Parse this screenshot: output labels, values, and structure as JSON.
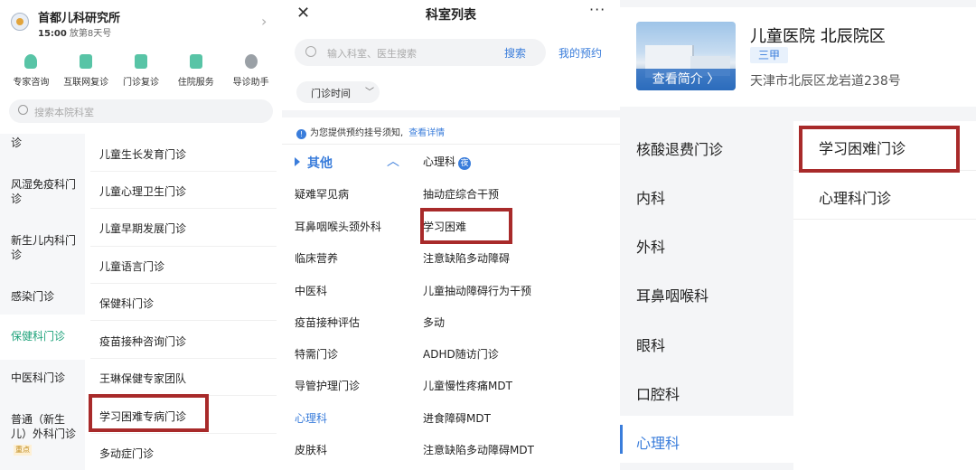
{
  "panel1": {
    "hospital_name": "首都儿科研究所",
    "time": "15:00",
    "day_info": "放第8天号",
    "quick_actions": [
      {
        "label": "专家咨询",
        "icon": "expert-consult-icon",
        "color": "#58c4a6"
      },
      {
        "label": "互联网复诊",
        "icon": "online-revisit-icon",
        "color": "#58c4a6"
      },
      {
        "label": "门诊复诊",
        "icon": "outpatient-revisit-icon",
        "color": "#58c4a6"
      },
      {
        "label": "住院服务",
        "icon": "inpatient-service-icon",
        "color": "#58c4a6"
      },
      {
        "label": "导诊助手",
        "icon": "guide-assistant-icon",
        "color": "#9aa0a6"
      }
    ],
    "search_placeholder": "搜索本院科室",
    "left_menu": [
      {
        "label": "诊"
      },
      {
        "label": "风湿免疫科门诊"
      },
      {
        "label": "新生儿内科门诊"
      },
      {
        "label": "感染门诊"
      },
      {
        "label": "保健科门诊",
        "active": true
      },
      {
        "label": "中医科门诊"
      },
      {
        "label": "普通（新生儿）外科门诊",
        "tag": "重点"
      }
    ],
    "right_list": [
      "儿童生长发育门诊",
      "儿童心理卫生门诊",
      "儿童早期发展门诊",
      "儿童语言门诊",
      "保健科门诊",
      "疫苗接种咨询门诊",
      "王琳保健专家团队",
      "学习困难专病门诊",
      "多动症门诊"
    ]
  },
  "panel2": {
    "title": "科室列表",
    "search_placeholder": "输入科室、医生搜索",
    "search_button": "搜索",
    "my_appointment": "我的预约",
    "filter_label": "门诊时间",
    "notice_text": "为您提供预约挂号须知,",
    "notice_link": "查看详情",
    "category": "其他",
    "left_col": [
      "疑难罕见病",
      "耳鼻咽喉头颈外科",
      "临床营养",
      "中医科",
      "疫苗接种评估",
      "特需门诊",
      "导管护理门诊",
      "心理科",
      "皮肤科"
    ],
    "left_active": "心理科",
    "right_header": "心理科",
    "night_badge": "夜",
    "right_col": [
      "抽动症综合干预",
      "学习困难",
      "注意缺陷多动障碍",
      "儿童抽动障碍行为干预",
      "多动",
      "ADHD随访门诊",
      "儿童慢性疼痛MDT",
      "进食障碍MDT",
      "注意缺陷多动障碍MDT"
    ]
  },
  "panel3": {
    "hospital_name": "儿童医院 北辰院区",
    "grade": "三甲",
    "address": "天津市北辰区龙岩道238号",
    "intro_button": "查看简介 〉",
    "left_menu": [
      "核酸退费门诊",
      "内科",
      "外科",
      "耳鼻咽喉科",
      "眼科",
      "口腔科",
      "心理科"
    ],
    "left_active": "心理科",
    "right_list": [
      "学习困难门诊",
      "心理科门诊"
    ]
  },
  "highlight_color": "#a82a2a",
  "accent_color": "#3a7ddb",
  "green_color": "#1ea27a"
}
